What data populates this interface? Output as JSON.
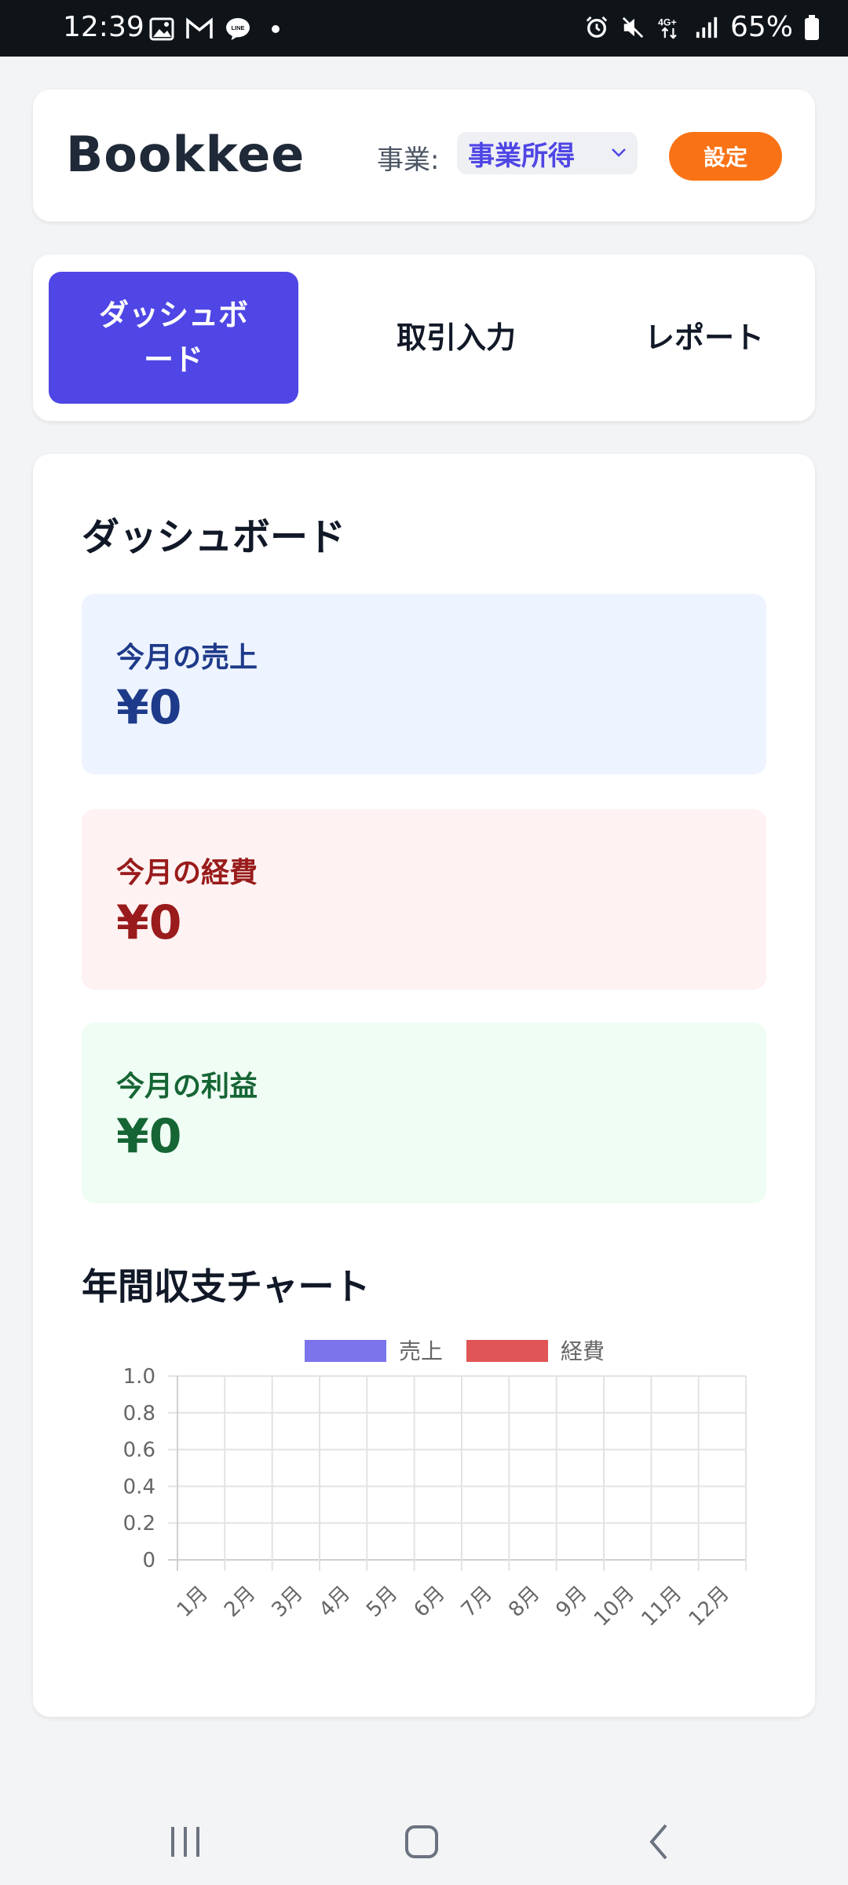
{
  "status_bar": {
    "time": "12:39",
    "battery": "65%",
    "left_icons": [
      "image-icon",
      "gmail-icon",
      "line-icon"
    ],
    "right_icons": [
      "alarm-icon",
      "mute-icon",
      "4g-icon",
      "signal-icon",
      "battery-icon"
    ]
  },
  "header": {
    "title": "Bookkee",
    "business_label": "事業:",
    "business_value": "事業所得",
    "settings_label": "設定"
  },
  "tabs": [
    {
      "label": "ダッシュボード",
      "active": true
    },
    {
      "label": "取引入力",
      "active": false
    },
    {
      "label": "レポート",
      "active": false
    }
  ],
  "dashboard": {
    "title": "ダッシュボード",
    "sales": {
      "label": "今月の売上",
      "value": "¥0"
    },
    "expenses": {
      "label": "今月の経費",
      "value": "¥0"
    },
    "profit": {
      "label": "今月の利益",
      "value": "¥0"
    },
    "chart_title": "年間収支チャート"
  },
  "colors": {
    "accent": "#4f46e5",
    "settings": "#f97316",
    "sales_series": "#7b74ea",
    "expense_series": "#e05656"
  },
  "chart_data": {
    "type": "bar",
    "categories": [
      "1月",
      "2月",
      "3月",
      "4月",
      "5月",
      "6月",
      "7月",
      "8月",
      "9月",
      "10月",
      "11月",
      "12月"
    ],
    "series": [
      {
        "name": "売上",
        "values": [
          0,
          0,
          0,
          0,
          0,
          0,
          0,
          0,
          0,
          0,
          0,
          0
        ],
        "color": "#7b74ea"
      },
      {
        "name": "経費",
        "values": [
          0,
          0,
          0,
          0,
          0,
          0,
          0,
          0,
          0,
          0,
          0,
          0
        ],
        "color": "#e05656"
      }
    ],
    "y_ticks": [
      "1.0",
      "0.8",
      "0.6",
      "0.4",
      "0.2",
      "0"
    ],
    "ylim": [
      0,
      1
    ],
    "grid": true,
    "legend_position": "top"
  }
}
